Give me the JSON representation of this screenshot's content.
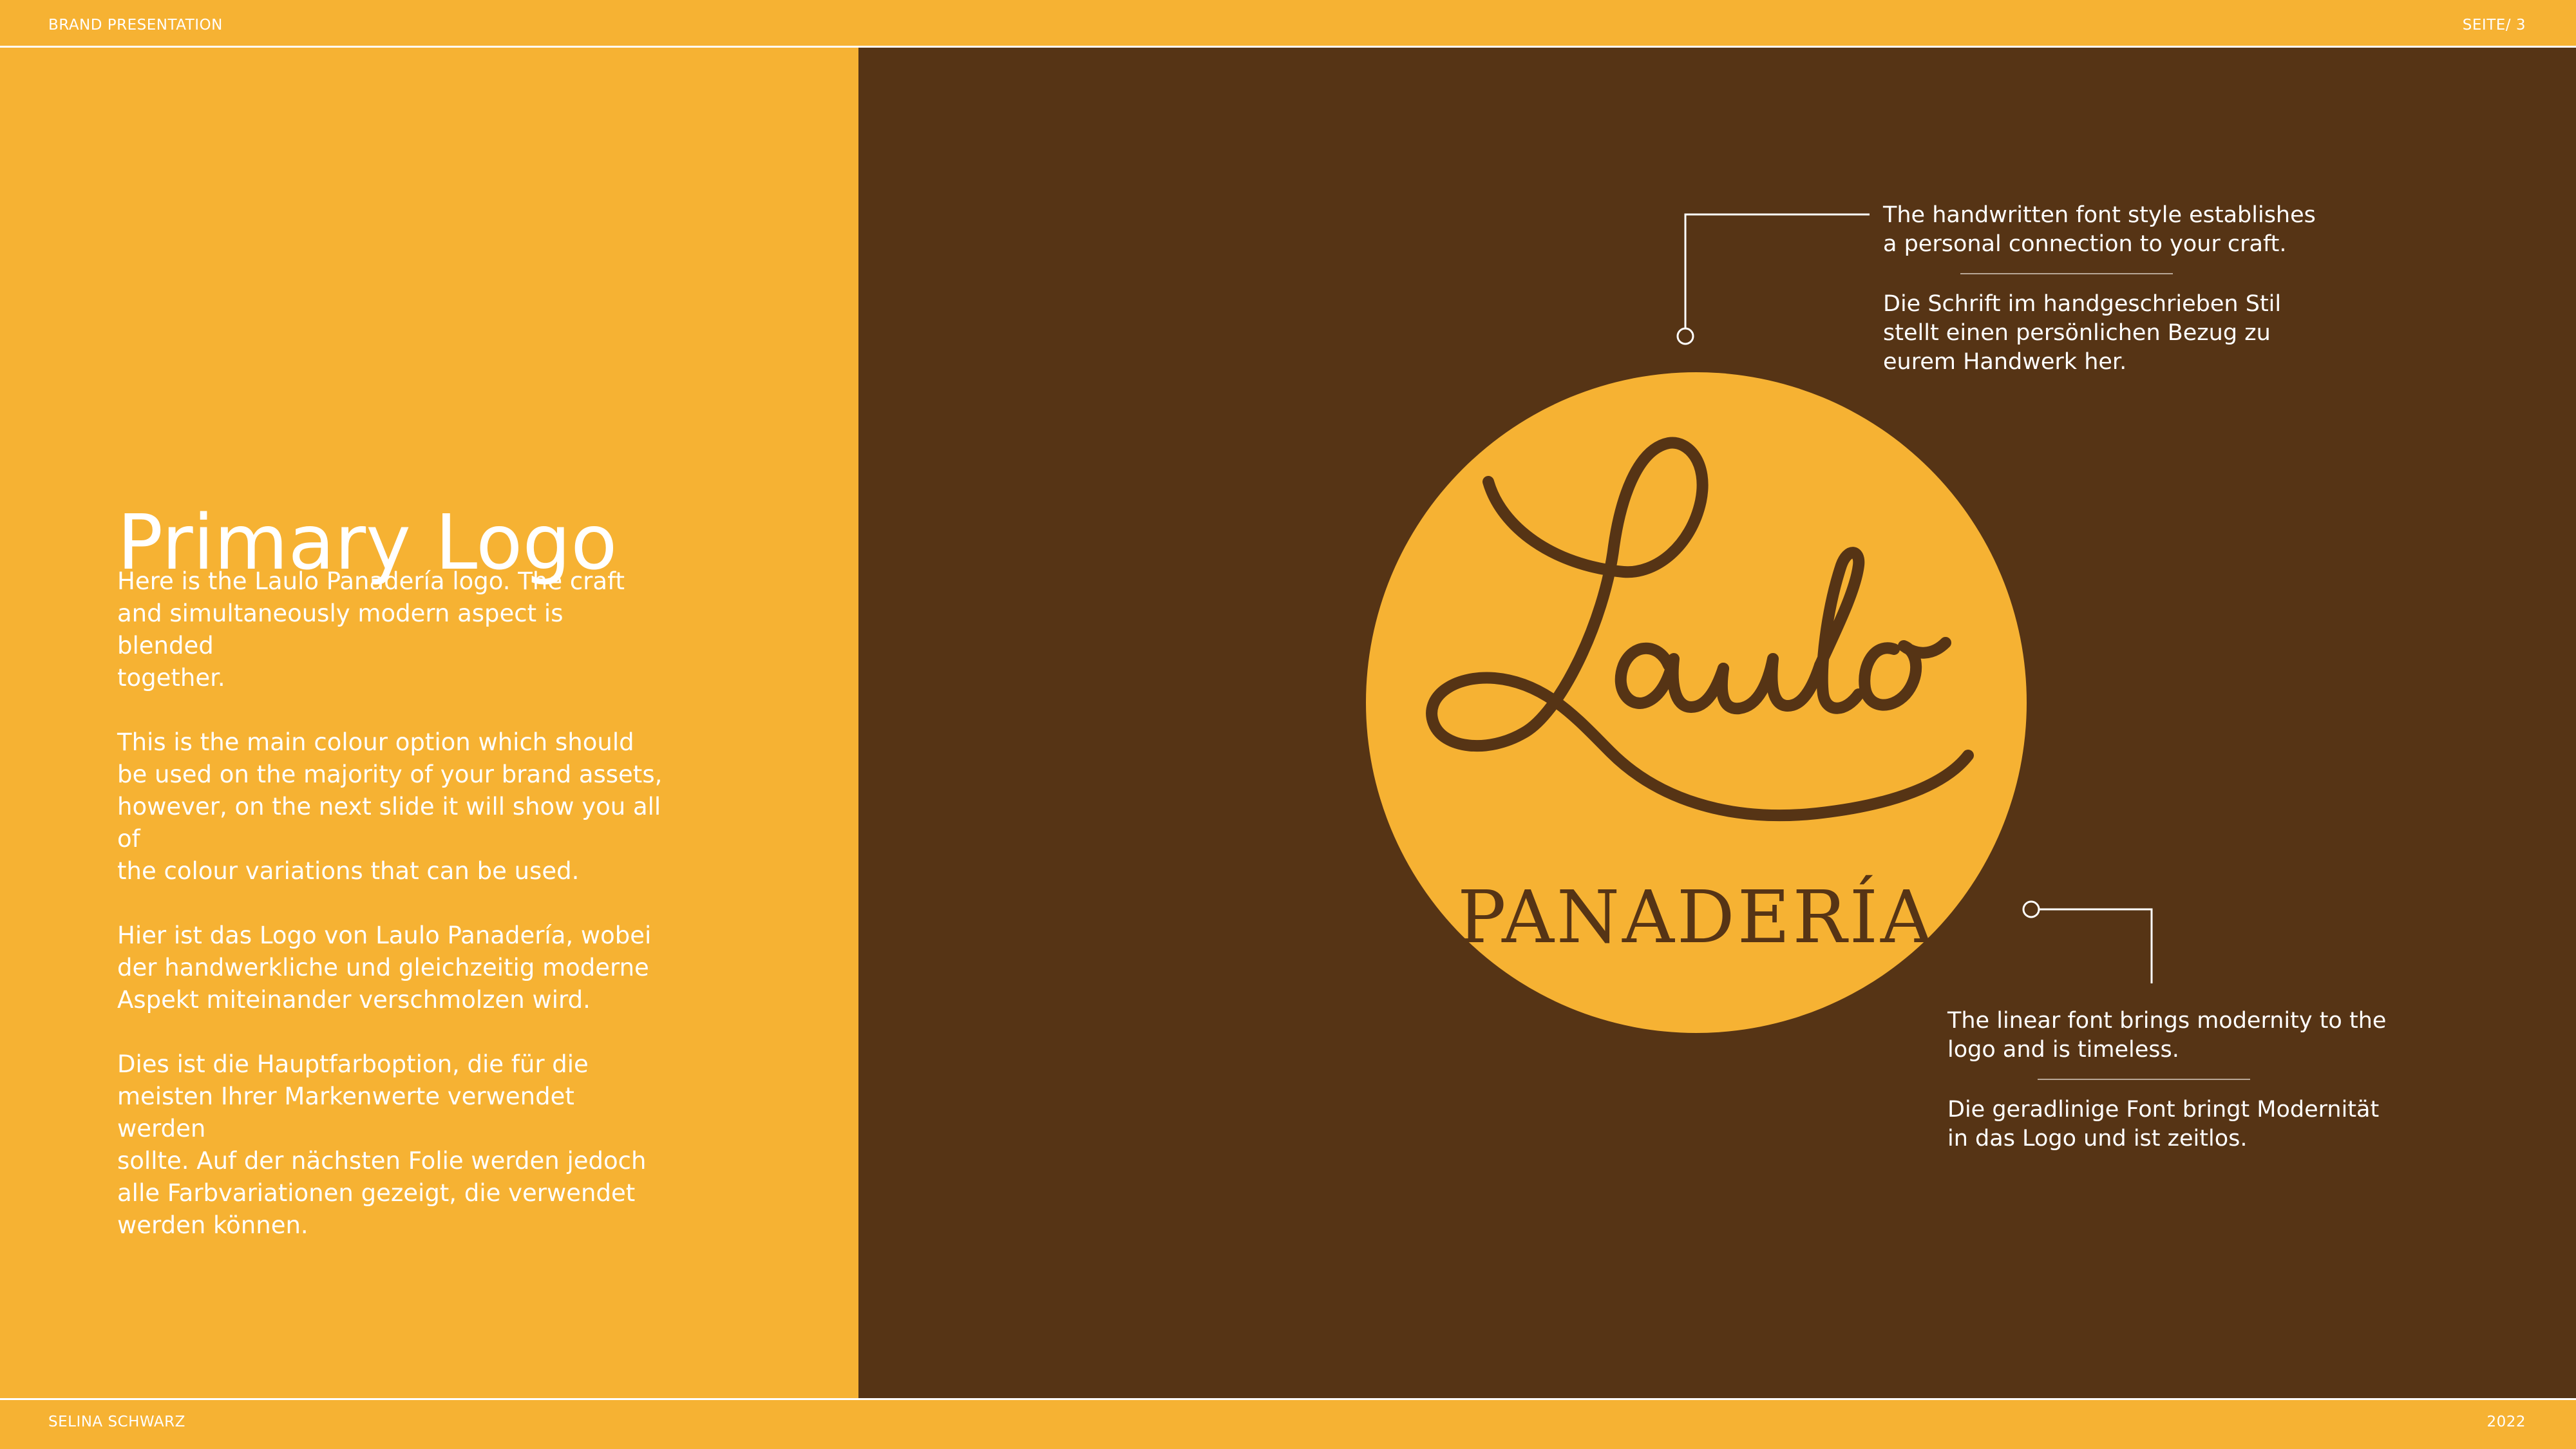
{
  "header": {
    "left_label": "BRAND PRESENTATION",
    "right_label": "SEITE/ 3"
  },
  "footer": {
    "left_label": "SELINA SCHWARZ",
    "right_label": "2022"
  },
  "left": {
    "title": "Primary Logo",
    "paragraphs": [
      "Here is the Laulo Panadería logo. The craft\nand simultaneously modern aspect is blended\ntogether.",
      "This is the main colour option which should\nbe used on the majority of your brand assets,\nhowever, on the next slide it will show you all of\nthe colour variations that can be used.",
      "Hier ist das Logo von Laulo Panadería, wobei\nder handwerkliche und gleichzeitig moderne\nAspekt miteinander verschmolzen wird.",
      "Dies ist die Hauptfarboption, die für die\nmeisten Ihrer Markenwerte verwendet werden\nsollte. Auf der nächsten Folie werden jedoch\nalle Farbvariationen gezeigt, die verwendet\nwerden können."
    ]
  },
  "logo": {
    "script_word": "Laulo",
    "wordmark": "PANADERÍA"
  },
  "callouts": {
    "top": {
      "en": "The handwritten font style establishes\na personal connection to your craft.",
      "de": "Die Schrift im handgeschrieben Stil\nstellt einen persönlichen Bezug zu\neurem Handwerk her."
    },
    "bottom": {
      "en": "The linear font brings modernity to the\nlogo and is timeless.",
      "de": "Die geradlinige Font  bringt Modernität\nin das Logo und ist zeitlos."
    }
  },
  "colors": {
    "yellow": "#F6B233",
    "brown": "#563415",
    "white": "#FFFFFF"
  }
}
